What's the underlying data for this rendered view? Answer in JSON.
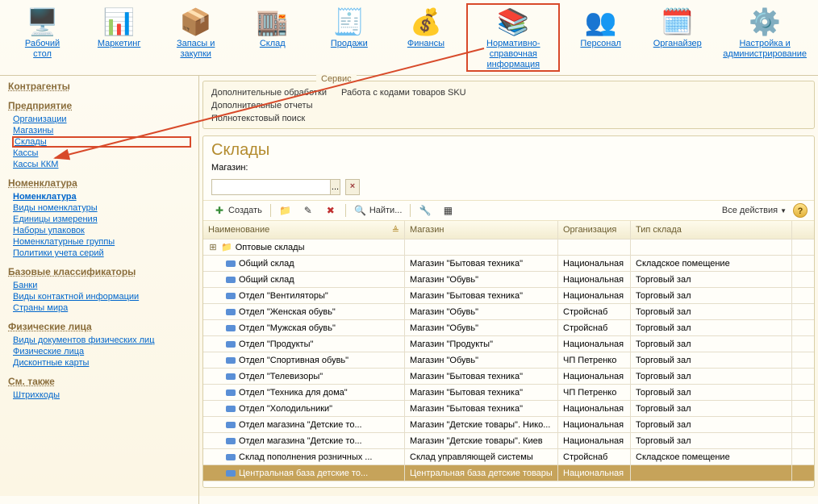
{
  "topbar": [
    {
      "label": "Рабочий\nстол",
      "icon": "🖥️"
    },
    {
      "label": "Маркетинг",
      "icon": "📊"
    },
    {
      "label": "Запасы и\nзакупки",
      "icon": "📦"
    },
    {
      "label": "Склад",
      "icon": "🏬"
    },
    {
      "label": "Продажи",
      "icon": "🧾"
    },
    {
      "label": "Финансы",
      "icon": "💰"
    },
    {
      "label": "Нормативно-справочная\nинформация",
      "icon": "📚",
      "highlighted": true,
      "wide": true
    },
    {
      "label": "Персонал",
      "icon": "👥"
    },
    {
      "label": "Органайзер",
      "icon": "🗓️"
    },
    {
      "label": "Настройка и\nадминистрирование",
      "icon": "⚙️",
      "wide": true
    }
  ],
  "sidebar": [
    {
      "head": "Контрагенты",
      "items": []
    },
    {
      "head": "Предприятие",
      "items": [
        {
          "label": "Организации"
        },
        {
          "label": "Магазины"
        },
        {
          "label": "Склады",
          "selected": true
        },
        {
          "label": "Кассы"
        },
        {
          "label": "Кассы ККМ"
        }
      ]
    },
    {
      "head": "Номенклатура",
      "items": [
        {
          "label": "Номенклатура",
          "bold": true
        },
        {
          "label": "Виды номенклатуры"
        },
        {
          "label": "Единицы измерения"
        },
        {
          "label": "Наборы упаковок"
        },
        {
          "label": "Номенклатурные группы"
        },
        {
          "label": "Политики учета серий"
        }
      ]
    },
    {
      "head": "Базовые классификаторы",
      "items": [
        {
          "label": "Банки"
        },
        {
          "label": "Виды контактной информации"
        },
        {
          "label": "Страны мира"
        }
      ]
    },
    {
      "head": "Физические лица",
      "items": [
        {
          "label": "Виды документов физических лиц"
        },
        {
          "label": "Физические лица"
        },
        {
          "label": "Дисконтные карты"
        }
      ]
    },
    {
      "head": "См. также",
      "items": [
        {
          "label": "Штрихкоды"
        }
      ]
    }
  ],
  "service": {
    "title": "Сервис",
    "left": [
      "Дополнительные обработки",
      "Дополнительные отчеты",
      "Полнотекстовый поиск"
    ],
    "right": [
      "Работа с кодами товаров SKU"
    ]
  },
  "list": {
    "title": "Склады",
    "filter_label": "Магазин:",
    "filter_value": "",
    "dots": "...",
    "clear": "×",
    "toolbar": {
      "create": "Создать",
      "find": "Найти...",
      "all_actions": "Все действия"
    },
    "columns": [
      "Наименование",
      "Магазин",
      "Организация",
      "Тип склада"
    ],
    "rows": [
      {
        "type": "folder",
        "name": "Оптовые склады",
        "magazin": "",
        "org": "",
        "tip": ""
      },
      {
        "type": "item",
        "name": "Общий склад",
        "magazin": "Магазин \"Бытовая техника\"",
        "org": "Национальная",
        "tip": "Складское помещение"
      },
      {
        "type": "item",
        "name": "Общий склад",
        "magazin": "Магазин \"Обувь\"",
        "org": "Национальная",
        "tip": "Торговый зал"
      },
      {
        "type": "item",
        "name": "Отдел \"Вентиляторы\"",
        "magazin": "Магазин \"Бытовая техника\"",
        "org": "Национальная",
        "tip": "Торговый зал"
      },
      {
        "type": "item",
        "name": "Отдел \"Женская обувь\"",
        "magazin": "Магазин \"Обувь\"",
        "org": "Стройснаб",
        "tip": "Торговый зал"
      },
      {
        "type": "item",
        "name": "Отдел \"Мужская обувь\"",
        "magazin": "Магазин \"Обувь\"",
        "org": "Стройснаб",
        "tip": "Торговый зал"
      },
      {
        "type": "item",
        "name": "Отдел \"Продукты\"",
        "magazin": "Магазин \"Продукты\"",
        "org": "Национальная",
        "tip": "Торговый зал"
      },
      {
        "type": "item",
        "name": "Отдел \"Спортивная обувь\"",
        "magazin": "Магазин \"Обувь\"",
        "org": "ЧП Петренко",
        "tip": "Торговый зал"
      },
      {
        "type": "item",
        "name": "Отдел \"Телевизоры\"",
        "magazin": "Магазин \"Бытовая техника\"",
        "org": "Национальная",
        "tip": "Торговый зал"
      },
      {
        "type": "item",
        "name": "Отдел \"Техника для дома\"",
        "magazin": "Магазин \"Бытовая техника\"",
        "org": "ЧП Петренко",
        "tip": "Торговый зал"
      },
      {
        "type": "item",
        "name": "Отдел \"Холодильники\"",
        "magazin": "Магазин \"Бытовая техника\"",
        "org": "Национальная",
        "tip": "Торговый зал"
      },
      {
        "type": "item",
        "name": "Отдел магазина \"Детские то...",
        "magazin": "Магазин \"Детские товары\". Нико...",
        "org": "Национальная",
        "tip": "Торговый зал"
      },
      {
        "type": "item",
        "name": "Отдел магазина \"Детские то...",
        "magazin": "Магазин \"Детские товары\". Киев",
        "org": "Национальная",
        "tip": "Торговый зал"
      },
      {
        "type": "item",
        "name": "Склад пополнения розничных ...",
        "magazin": "Склад управляющей системы",
        "org": "Стройснаб",
        "tip": "Складское помещение"
      },
      {
        "type": "item",
        "name": "Центральная база детские то...",
        "magazin": "Центральная база детские товары",
        "org": "Национальная",
        "tip": "",
        "selected": true
      }
    ]
  }
}
